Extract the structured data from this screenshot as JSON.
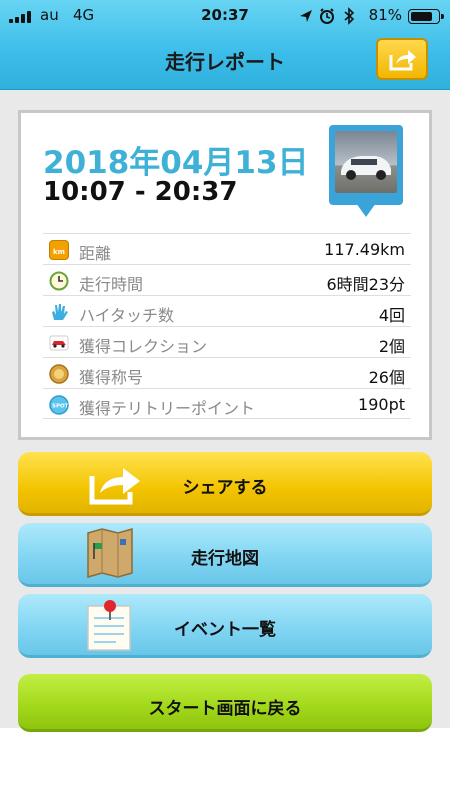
{
  "status_bar": {
    "carrier": "au",
    "network": "4G",
    "time": "20:37",
    "battery": "81%",
    "battery_level": 0.81
  },
  "header": {
    "title": "走行レポート",
    "share_icon": "share-arrow-icon"
  },
  "report": {
    "date": "2018年04月13日",
    "time_range": "10:07 - 20:37",
    "photo_icon": "car-photo-pin",
    "stats": [
      {
        "icon": "km",
        "label": "距離",
        "value": "117.49km"
      },
      {
        "icon": "clock",
        "label": "走行時間",
        "value": "6時間23分"
      },
      {
        "icon": "hand",
        "label": "ハイタッチ数",
        "value": "4回"
      },
      {
        "icon": "car",
        "label": "獲得コレクション",
        "value": "2個"
      },
      {
        "icon": "medal",
        "label": "獲得称号",
        "value": "26個"
      },
      {
        "icon": "spot",
        "label": "獲得テリトリーポイント",
        "value": "190pt"
      }
    ]
  },
  "buttons": {
    "share": "シェアする",
    "map": "走行地図",
    "events": "イベント一覧",
    "back_to_start": "スタート画面に戻る"
  },
  "colors": {
    "header": "#3cbde9",
    "date_text": "#3fb1d6",
    "share_button": "#f3c400",
    "blue_button": "#7fd4f2",
    "green_button": "#a2d81a"
  }
}
